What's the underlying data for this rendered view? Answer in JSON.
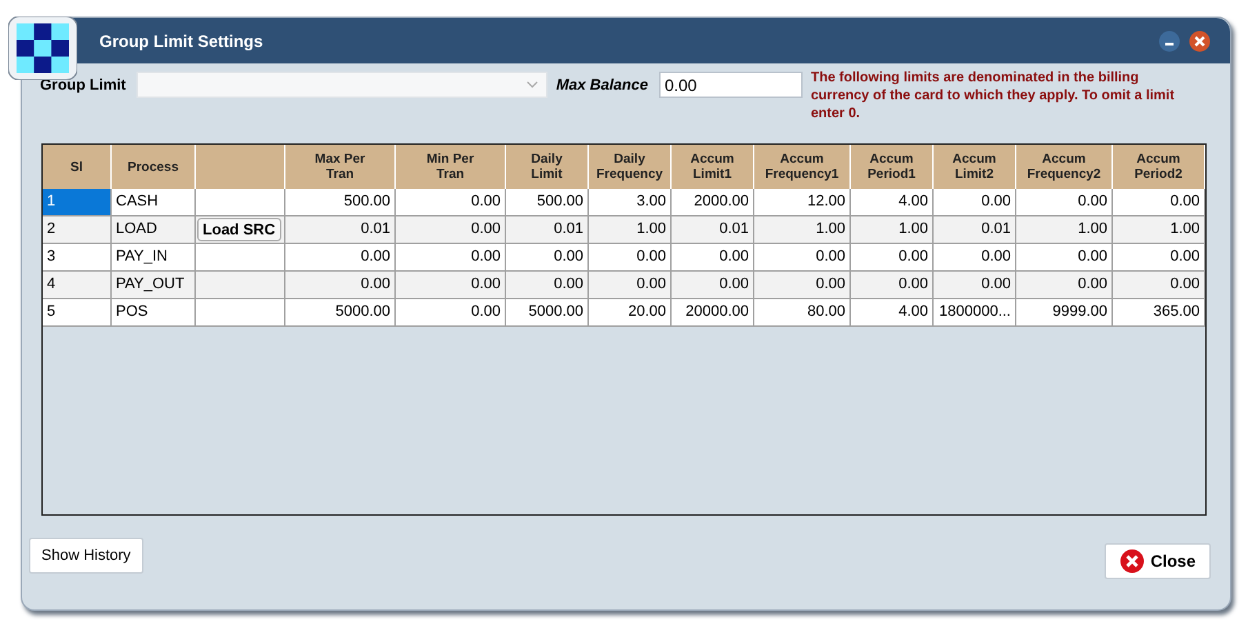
{
  "window": {
    "title": "Group Limit Settings"
  },
  "group_limit": {
    "label": "Group Limit"
  },
  "max_balance": {
    "label": "Max Balance",
    "value": "0.00"
  },
  "notice": "The following limits are denominated in the billing currency of the card to which they apply. To omit a limit enter 0.",
  "table": {
    "columns": [
      "Sl",
      "Process",
      "",
      "Max Per Tran",
      "Min Per Tran",
      "Daily Limit",
      "Daily Frequency",
      "Accum Limit1",
      "Accum Frequency1",
      "Accum Period1",
      "Accum Limit2",
      "Accum Frequency2",
      "Accum Period2"
    ],
    "rows": [
      {
        "sl": "1",
        "process": "CASH",
        "selected": true,
        "values": [
          "500.00",
          "0.00",
          "500.00",
          "3.00",
          "2000.00",
          "12.00",
          "4.00",
          "0.00",
          "0.00",
          "0.00"
        ]
      },
      {
        "sl": "2",
        "process": "LOAD",
        "action": "Load SRC",
        "selected": false,
        "values": [
          "0.01",
          "0.00",
          "0.01",
          "1.00",
          "0.01",
          "1.00",
          "1.00",
          "0.01",
          "1.00",
          "1.00"
        ]
      },
      {
        "sl": "3",
        "process": "PAY_IN",
        "selected": false,
        "values": [
          "0.00",
          "0.00",
          "0.00",
          "0.00",
          "0.00",
          "0.00",
          "0.00",
          "0.00",
          "0.00",
          "0.00"
        ]
      },
      {
        "sl": "4",
        "process": "PAY_OUT",
        "selected": false,
        "values": [
          "0.00",
          "0.00",
          "0.00",
          "0.00",
          "0.00",
          "0.00",
          "0.00",
          "0.00",
          "0.00",
          "0.00"
        ]
      },
      {
        "sl": "5",
        "process": "POS",
        "selected": false,
        "values": [
          "5000.00",
          "0.00",
          "5000.00",
          "20.00",
          "20000.00",
          "80.00",
          "4.00",
          "1800000...",
          "9999.00",
          "365.00"
        ]
      }
    ]
  },
  "buttons": {
    "history": "Show History",
    "close": "Close"
  }
}
